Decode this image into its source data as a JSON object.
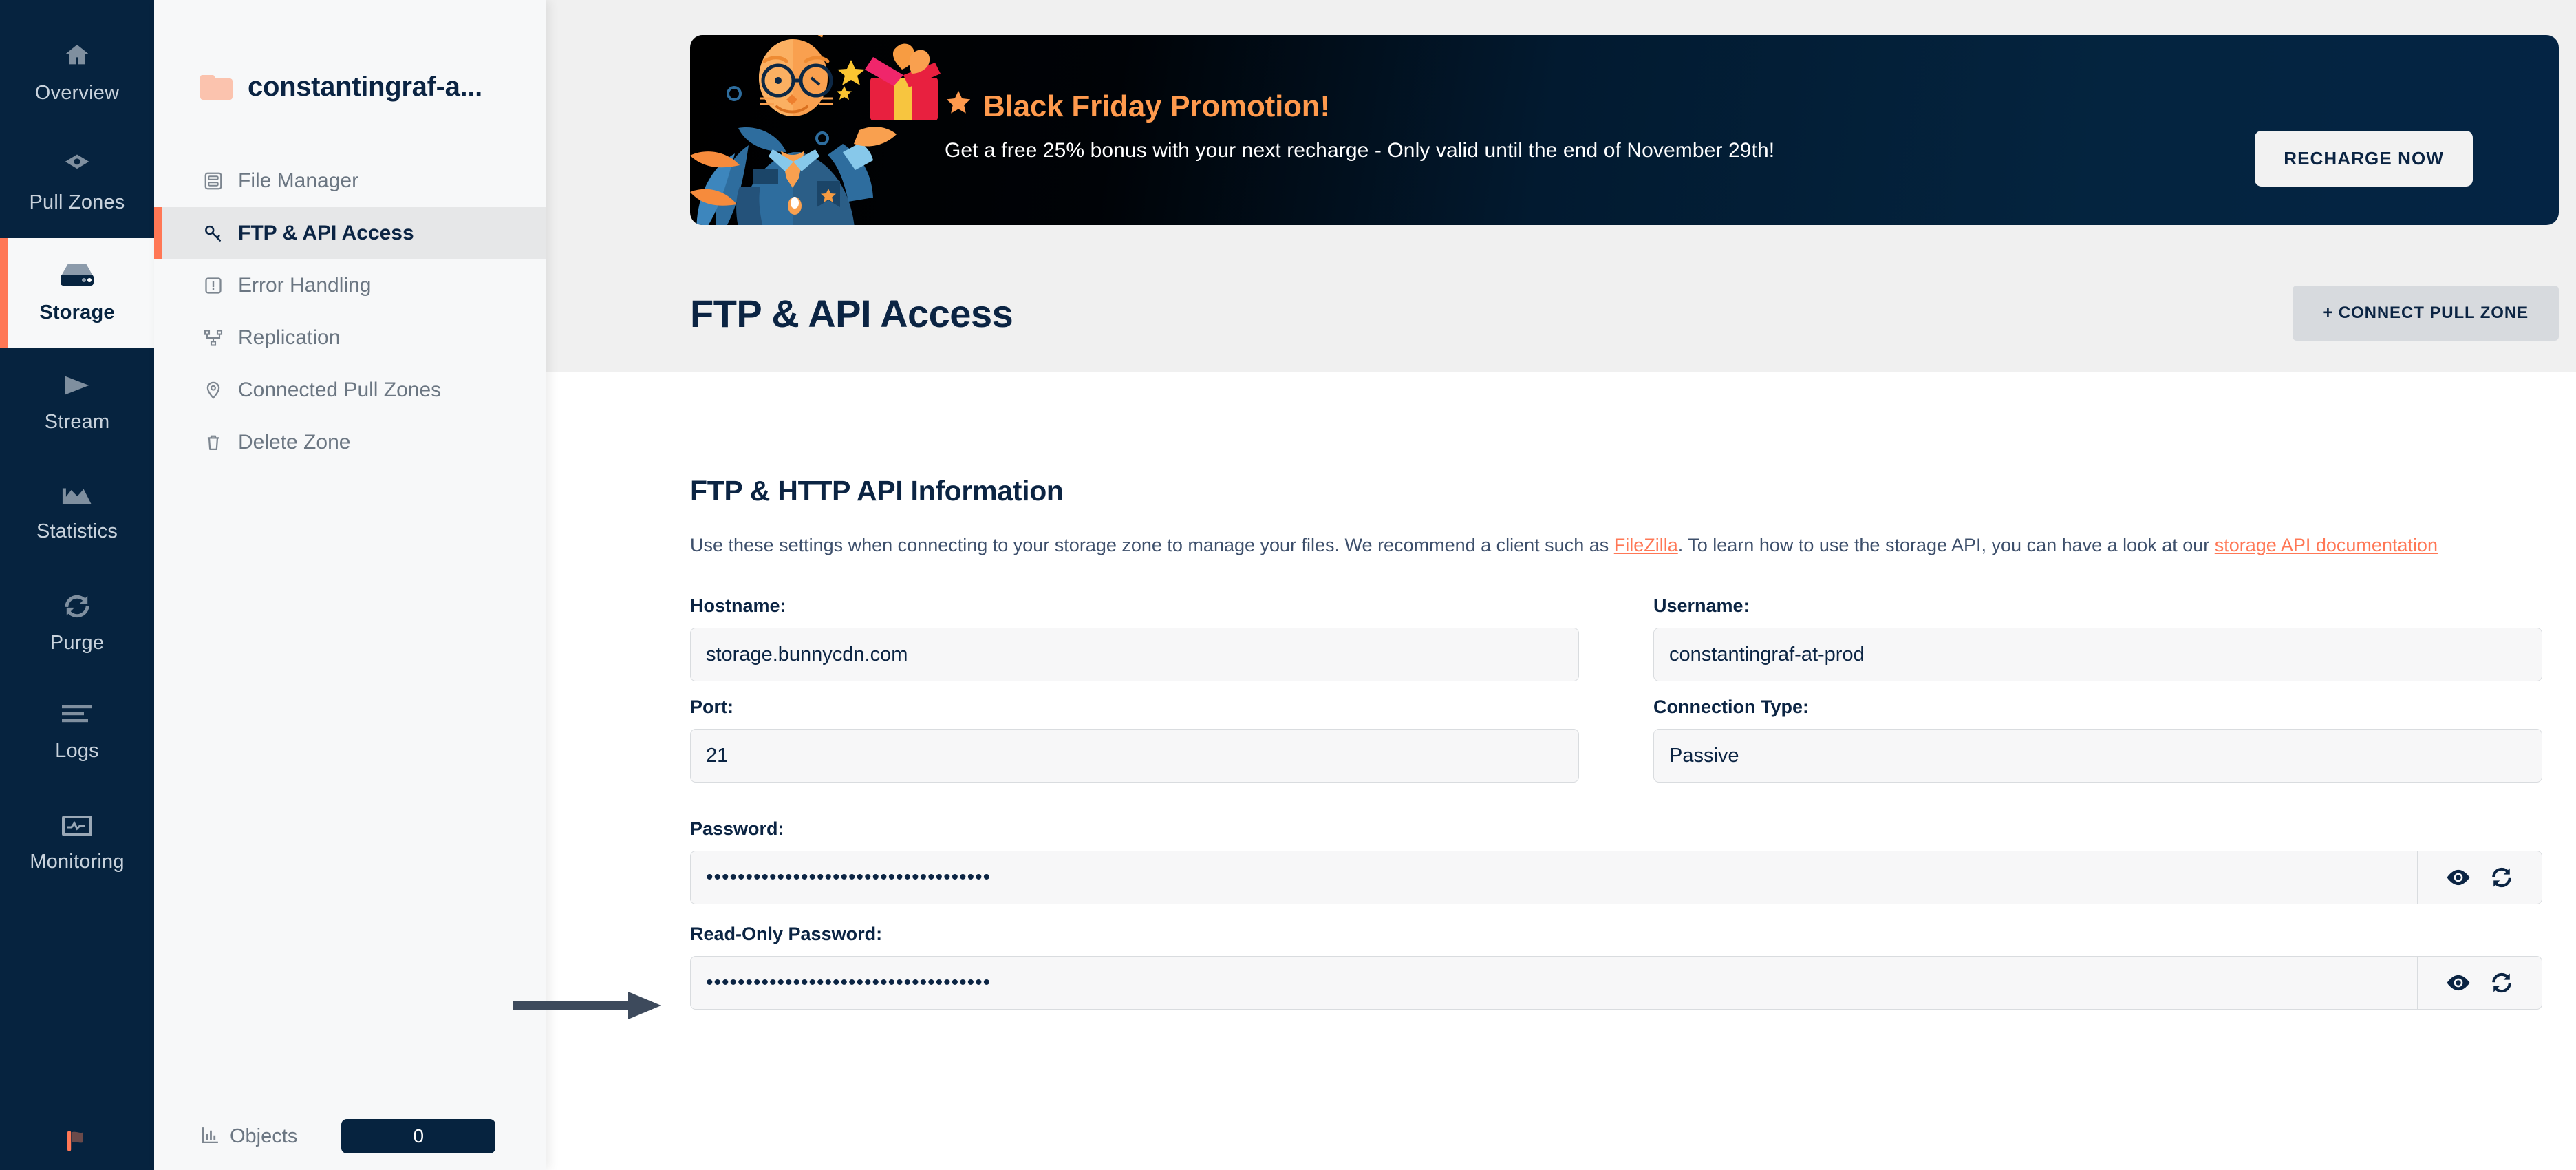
{
  "primary_nav": {
    "items": [
      {
        "label": "Overview",
        "icon": "home-icon",
        "active": false
      },
      {
        "label": "Pull Zones",
        "icon": "pullzones-icon",
        "active": false
      },
      {
        "label": "Storage",
        "icon": "storage-icon",
        "active": true
      },
      {
        "label": "Stream",
        "icon": "play-icon",
        "active": false
      },
      {
        "label": "Statistics",
        "icon": "chart-icon",
        "active": false
      },
      {
        "label": "Purge",
        "icon": "refresh-icon",
        "active": false
      },
      {
        "label": "Logs",
        "icon": "list-icon",
        "active": false
      },
      {
        "label": "Monitoring",
        "icon": "monitor-icon",
        "active": false
      }
    ],
    "flag_icon": "flag-icon"
  },
  "secondary_nav": {
    "zone_name": "constantingraf-a...",
    "zone_icon": "folder-icon",
    "items": [
      {
        "label": "File Manager",
        "icon": "file-manager-icon",
        "active": false
      },
      {
        "label": "FTP & API Access",
        "icon": "key-icon",
        "active": true
      },
      {
        "label": "Error Handling",
        "icon": "alert-box-icon",
        "active": false
      },
      {
        "label": "Replication",
        "icon": "replication-icon",
        "active": false
      },
      {
        "label": "Connected Pull Zones",
        "icon": "map-pin-icon",
        "active": false
      },
      {
        "label": "Delete Zone",
        "icon": "trash-icon",
        "active": false
      }
    ],
    "objects_label": "Objects",
    "objects_icon": "bar-chart-icon",
    "objects_count": "0"
  },
  "promo_banner": {
    "star_icon": "star-icon",
    "title": "Black Friday Promotion!",
    "subtitle": "Get a free 25% bonus with your next recharge - Only valid until the end of November 29th!",
    "cta_label": "RECHARGE NOW",
    "art_alt": "bunny-mascot-illustration"
  },
  "page": {
    "title": "FTP & API Access",
    "connect_button_label": "+ CONNECT PULL ZONE",
    "section_title": "FTP & HTTP API Information",
    "description": {
      "part1": "Use these settings when connecting to your storage zone to manage your files. We recommend a client such as ",
      "link1": "FileZilla",
      "part2": ". To learn how to use the storage API, you can have a look at our ",
      "link2": "storage API documentation"
    }
  },
  "form": {
    "hostname": {
      "label": "Hostname:",
      "value": "storage.bunnycdn.com"
    },
    "username": {
      "label": "Username:",
      "value": "constantingraf-at-prod"
    },
    "port": {
      "label": "Port:",
      "value": "21"
    },
    "connection_type": {
      "label": "Connection Type:",
      "value": "Passive"
    },
    "password": {
      "label": "Password:",
      "value": "••••••••••••••••••••••••••••••••••••",
      "show_icon": "eye-icon",
      "regenerate_icon": "refresh-icon"
    },
    "readonly_password": {
      "label": "Read-Only Password:",
      "value": "••••••••••••••••••••••••••••••••••••",
      "show_icon": "eye-icon",
      "regenerate_icon": "refresh-icon"
    }
  },
  "annotation": {
    "arrow_icon": "arrow-right-annotation",
    "target": "password-field"
  },
  "colors": {
    "sidebar_dark": "#06233f",
    "accent_orange": "#ff7755",
    "promo_orange": "#ff9a4d",
    "text_navy": "#0b2443",
    "panel_gray": "#f7f8f9",
    "header_gray": "#f0f0f0"
  }
}
